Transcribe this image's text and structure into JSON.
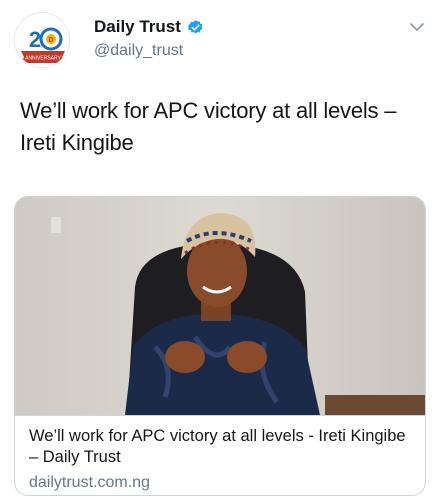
{
  "account": {
    "display_name": "Daily Trust",
    "handle": "@daily_trust",
    "avatar_text": "20",
    "avatar_ribbon": "ANNIVERSARY",
    "verified": true
  },
  "tweet": {
    "text": "We’ll work for APC victory at all levels – Ireti Kingibe"
  },
  "link_card": {
    "title": "We’ll work for APC victory at all levels - Ireti Kingibe – Daily Trust",
    "domain": "dailytrust.com.ng"
  },
  "colors": {
    "verified": "#1da1f2",
    "secondary_text": "#657786",
    "border": "#ccd6dd"
  }
}
